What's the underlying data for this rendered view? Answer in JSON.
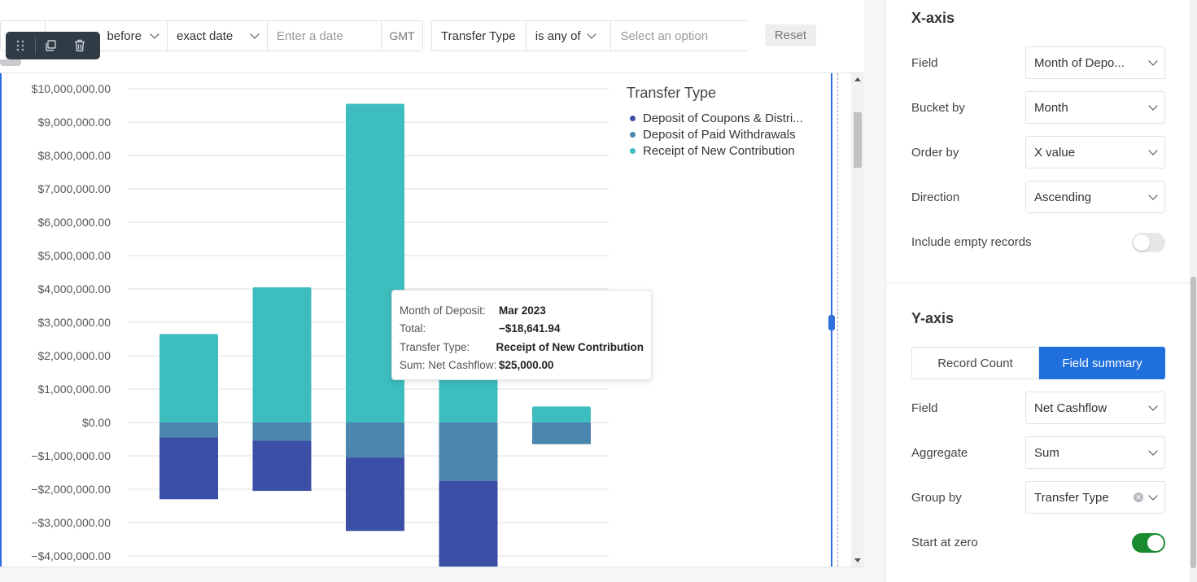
{
  "filters": {
    "date_group": {
      "operator": "before",
      "mode": "exact date",
      "placeholder": "Enter a date",
      "tz": "GMT"
    },
    "type_group": {
      "field": "Transfer Type",
      "operator": "is any of",
      "placeholder": "Select an option"
    },
    "reset_label": "Reset"
  },
  "chart_data": {
    "type": "bar",
    "stacked": true,
    "yticks": [
      "$10,000,000.00",
      "$9,000,000.00",
      "$8,000,000.00",
      "$7,000,000.00",
      "$6,000,000.00",
      "$5,000,000.00",
      "$4,000,000.00",
      "$3,000,000.00",
      "$2,000,000.00",
      "$1,000,000.00",
      "$0.00",
      "−$1,000,000.00",
      "−$2,000,000.00",
      "−$3,000,000.00",
      "−$4,000,000.00"
    ],
    "ylim": [
      -4000000,
      10000000
    ],
    "legend_title": "Transfer Type",
    "legend_position": "top-right",
    "grid": true,
    "series": [
      {
        "name": "Deposit of Coupons & Distri...",
        "color": "#3b4fa6",
        "values": [
          -1850000,
          -1500000,
          -2200000,
          -3050000,
          0
        ]
      },
      {
        "name": "Deposit of Paid Withdrawals",
        "color": "#4a86b0",
        "values": [
          -450000,
          -550000,
          -1050000,
          -1750000,
          -650000
        ]
      },
      {
        "name": "Receipt of New Contribution",
        "color": "#3dbdbe",
        "values": [
          2650000,
          4050000,
          9550000,
          1700000,
          480000
        ]
      }
    ]
  },
  "tooltip": {
    "rows": [
      {
        "k": "Month of Deposit:",
        "v": "Mar 2023"
      },
      {
        "k": "Total:",
        "v": "−$18,641.94"
      },
      {
        "k": "Transfer Type:",
        "v": "Receipt of New Contribution"
      },
      {
        "k": "Sum: Net Cashflow:",
        "v": "$25,000.00"
      }
    ]
  },
  "panel": {
    "xaxis": {
      "title": "X-axis",
      "field_label": "Field",
      "field_value": "Month of Depo...",
      "bucket_label": "Bucket by",
      "bucket_value": "Month",
      "order_label": "Order by",
      "order_value": "X value",
      "direction_label": "Direction",
      "direction_value": "Ascending",
      "empty_label": "Include empty records",
      "empty_on": false
    },
    "yaxis": {
      "title": "Y-axis",
      "seg_count": "Record Count",
      "seg_summary": "Field summary",
      "field_label": "Field",
      "field_value": "Net Cashflow",
      "aggregate_label": "Aggregate",
      "aggregate_value": "Sum",
      "group_label": "Group by",
      "group_value": "Transfer Type",
      "zero_label": "Start at zero",
      "zero_on": true
    }
  }
}
